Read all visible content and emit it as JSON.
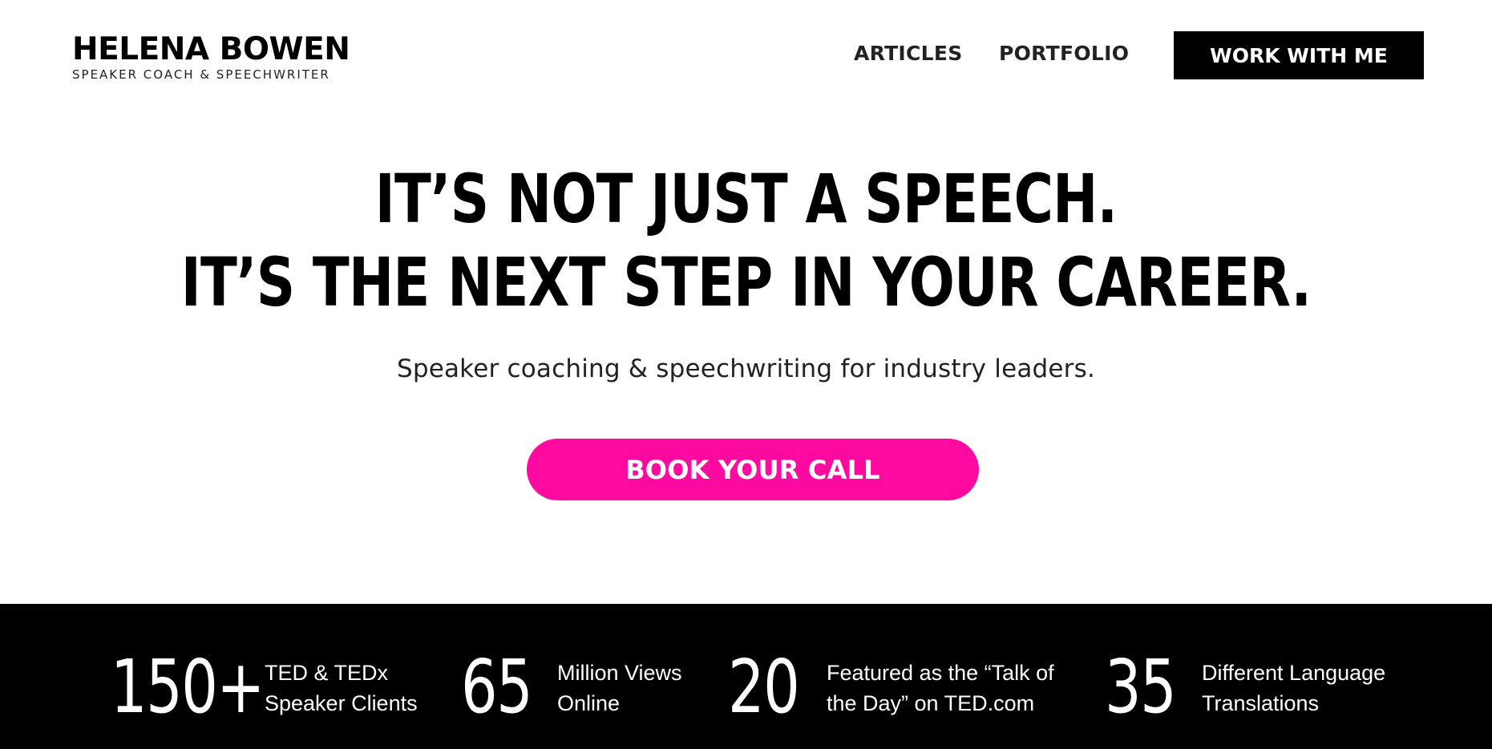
{
  "header": {
    "brand_name": "HELENA BOWEN",
    "brand_tagline": "SPEAKER COACH & SPEECHWRITER",
    "nav": [
      {
        "label": "ARTICLES"
      },
      {
        "label": "PORTFOLIO"
      }
    ],
    "cta_label": "WORK WITH ME"
  },
  "hero": {
    "headline_line1": "IT’S NOT JUST A SPEECH.",
    "headline_line2": "IT’S THE NEXT STEP IN YOUR CAREER.",
    "subheadline": "Speaker coaching & speechwriting for industry leaders.",
    "cta_label": "BOOK YOUR CALL"
  },
  "stats": [
    {
      "number": "150+",
      "label_line1": "TED & TEDx",
      "label_line2": "Speaker Clients"
    },
    {
      "number": "65",
      "label_line1": "Million Views",
      "label_line2": "Online"
    },
    {
      "number": "20",
      "label_line1": "Featured as the “Talk of",
      "label_line2": "the Day” on TED.com"
    },
    {
      "number": "35",
      "label_line1": "Different Language",
      "label_line2": "Translations"
    }
  ],
  "colors": {
    "accent": "#ff0aa0",
    "primary": "#000000",
    "background": "#ffffff"
  }
}
